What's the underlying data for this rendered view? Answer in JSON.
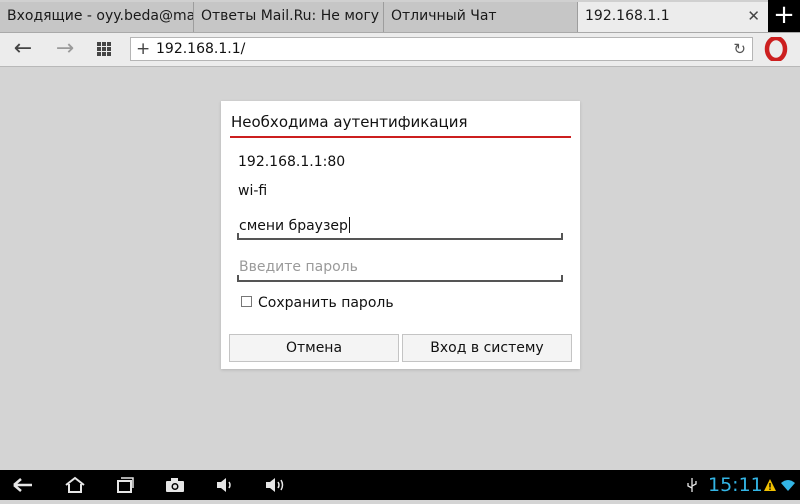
{
  "browser": {
    "tabs": [
      {
        "title": "Входящие - oyy.beda@mail",
        "active": false
      },
      {
        "title": "Ответы Mail.Ru: Не могу за",
        "active": false
      },
      {
        "title": "Отличный Чат",
        "active": false
      },
      {
        "title": "192.168.1.1",
        "active": true
      }
    ],
    "close_glyph": "✕",
    "new_tab_glyph": "+",
    "address": "192.168.1.1/",
    "accent_color": "#cc1f1f"
  },
  "dialog": {
    "title": "Необходима аутентификация",
    "host": "192.168.1.1:80",
    "realm": "wi-fi",
    "username_value": "смени браузер",
    "password_placeholder": "Введите пароль",
    "save_password_label": "Сохранить пароль",
    "save_password_checked": false,
    "cancel_label": "Отмена",
    "login_label": "Вход в систему"
  },
  "system_bar": {
    "time": "15:11",
    "clock_color": "#33b5e5"
  },
  "icons": {
    "nav": [
      "back-icon",
      "forward-icon",
      "grid-icon",
      "plus-icon",
      "reload-icon",
      "opera-logo"
    ],
    "system": [
      "back-icon",
      "home-icon",
      "recent-apps-icon",
      "camera-icon",
      "volume-down-icon",
      "volume-up-icon",
      "usb-icon",
      "warning-icon",
      "wifi-icon"
    ]
  }
}
